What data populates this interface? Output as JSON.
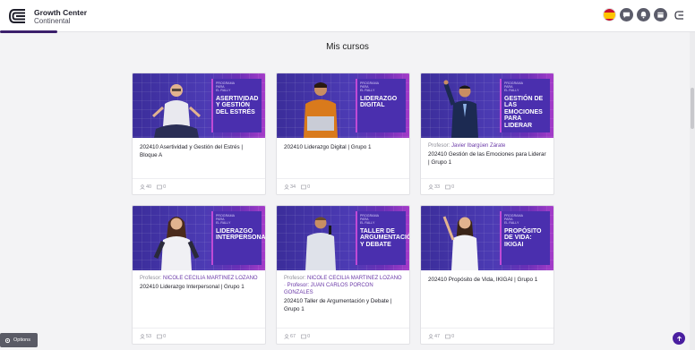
{
  "header": {
    "brand_line1": "Growth Center",
    "brand_line2": "Continental",
    "language_flag": "spain-flag-icon"
  },
  "main": {
    "title": "Mis cursos"
  },
  "courses": [
    {
      "banner_kicker": "PROGRAMA\nPARA\nEL RALLY",
      "banner_title": "ASERTIVIDAD Y GESTIÓN DEL ESTRÉS",
      "professor_label": "",
      "professor_name": "",
      "title": "202410 Asertividad y Gestión del Estrés | Bloque A",
      "students": "40",
      "tasks": "0"
    },
    {
      "banner_kicker": "PROGRAMA\nPARA\nEL RALLY",
      "banner_title": "LIDERAZGO DIGITAL",
      "professor_label": "",
      "professor_name": "",
      "title": "202410 Liderazgo Digital | Grupo 1",
      "students": "34",
      "tasks": "0"
    },
    {
      "banner_kicker": "PROGRAMA\nPARA\nEL RALLY",
      "banner_title": "GESTIÓN DE LAS EMOCIONES PARA LIDERAR",
      "professor_label": "Profesor:",
      "professor_name": "Javier Ibargüen Zárate",
      "title": "202410 Gestión de las Emociones para Liderar | Grupo 1",
      "students": "33",
      "tasks": "0"
    },
    {
      "banner_kicker": "PROGRAMA\nPARA\nEL RALLY",
      "banner_title": "LIDERAZGO INTERPERSONAL",
      "professor_label": "Profesor:",
      "professor_name": "NICOLE CECILIA MARTINEZ LOZANO",
      "title": "202410 Liderazgo Interpersonal | Grupo 1",
      "students": "53",
      "tasks": "0"
    },
    {
      "banner_kicker": "PROGRAMA\nPARA\nEL RALLY",
      "banner_title": "TALLER DE ARGUMENTACIÓN Y DEBATE",
      "professor_label": "Profesor:",
      "professor_name": "NICOLE CECILIA MARTINEZ LOZANO · Profesor: JUAN CARLOS PORCON GONZALES",
      "title": "202410 Taller de Argumentación y Debate | Grupo 1",
      "students": "67",
      "tasks": "0"
    },
    {
      "banner_kicker": "PROGRAMA\nPARA\nEL RALLY",
      "banner_title": "PROPÓSITO DE VIDA: IKIGAI",
      "professor_label": "",
      "professor_name": "",
      "title": "202410 Propósito de Vida, IKIGAI | Grupo 1",
      "students": "47",
      "tasks": "0"
    }
  ],
  "footer": {
    "options_label": "Options"
  },
  "colors": {
    "accent": "#4a1fa0",
    "professor_name": "#6b3aa8",
    "banner_start": "#3b2d9a",
    "banner_end": "#a53cc9"
  }
}
